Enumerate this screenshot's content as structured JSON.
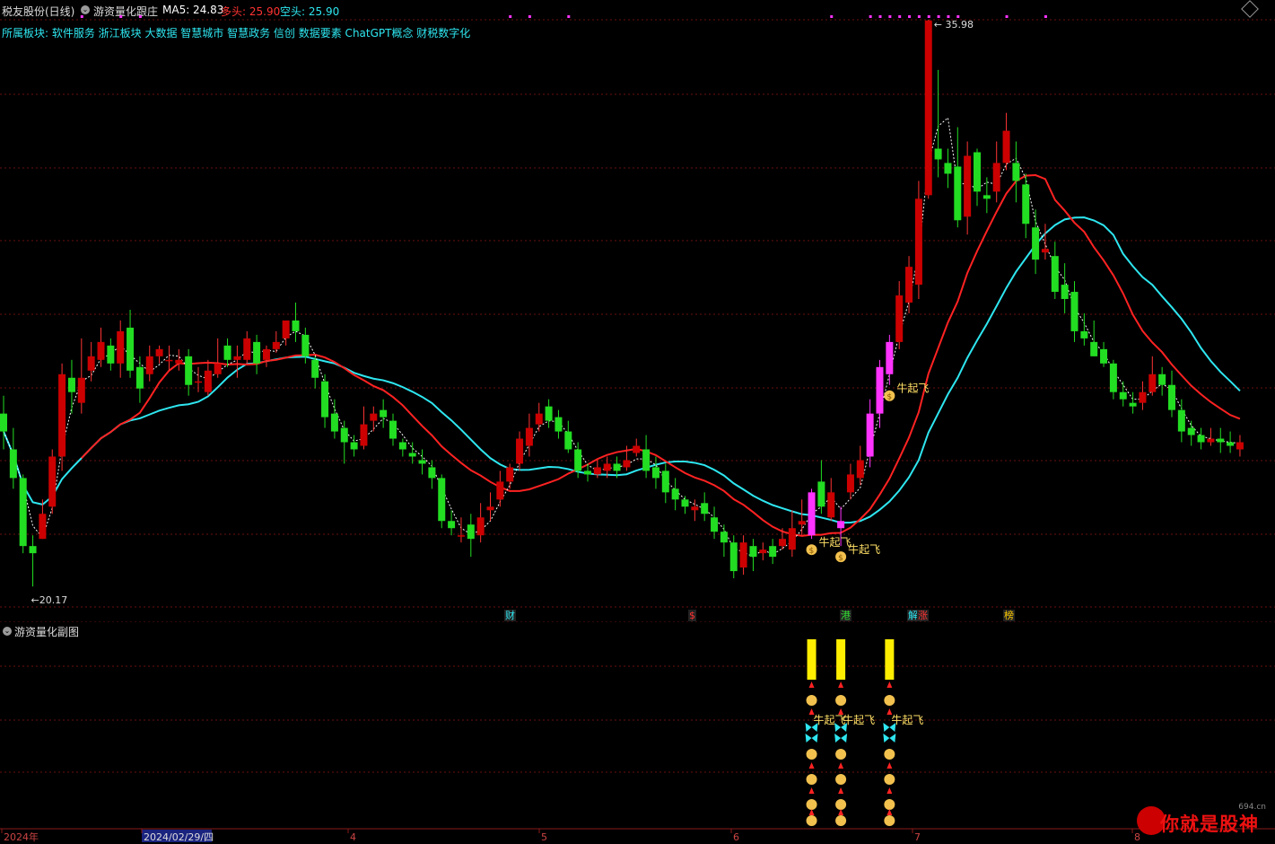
{
  "header": {
    "stock_name": "税友股份(日线)",
    "indicator_name": "游资量化跟庄",
    "ma5_label": "MA5: 24.83",
    "long_label": "多头: 25.90",
    "short_label": "空头: 25.90",
    "colors": {
      "ma5": "#ffffff",
      "long": "#ff3333",
      "short": "#2ee6f0"
    }
  },
  "sectors": "所属板块: 软件服务 浙江板块 大数据 智慧城市 智慧政务 信创 数据要素 ChatGPT概念 财税数字化",
  "main_chart": {
    "high_label": "35.98",
    "low_label": "←20.17",
    "signal_text": "牛起飞",
    "event_tags": [
      {
        "text": "财",
        "color": "#2ee6f0"
      },
      {
        "text": "$",
        "color": "#ff3333"
      },
      {
        "text": "港",
        "color": "#33dd33"
      },
      {
        "text": "解",
        "color": "#2ee6f0"
      },
      {
        "text": "涨",
        "color": "#ff3333"
      },
      {
        "text": "榜",
        "color": "#ffcc00"
      }
    ]
  },
  "sub_chart": {
    "title": "游资量化副图",
    "signal_text": "牛起飞"
  },
  "x_axis": {
    "labels": [
      "2024年",
      "2024/02/29/四",
      "4",
      "5",
      "6",
      "7",
      "8"
    ]
  },
  "watermark": {
    "domain": "694.cn",
    "text": "你就是股神"
  },
  "chart_data": {
    "type": "candlestick",
    "title": "游资量化跟庄",
    "y_high": 35.98,
    "y_low": 20.17,
    "candles": [
      [
        25.0,
        24.5,
        25.5,
        24.0
      ],
      [
        24.0,
        23.2,
        24.6,
        22.9
      ],
      [
        23.2,
        21.3,
        23.3,
        21.1
      ],
      [
        21.3,
        21.1,
        21.6,
        20.17
      ],
      [
        21.5,
        22.2,
        22.6,
        21.5
      ],
      [
        22.4,
        23.8,
        24.0,
        22.2
      ],
      [
        23.8,
        26.1,
        26.4,
        23.4
      ],
      [
        26.0,
        25.6,
        26.5,
        25.0
      ],
      [
        25.3,
        26.0,
        27.1,
        25.0
      ],
      [
        26.2,
        26.6,
        27.0,
        25.9
      ],
      [
        26.5,
        27.0,
        27.4,
        26.3
      ],
      [
        26.9,
        26.4,
        27.1,
        26.2
      ],
      [
        26.4,
        27.3,
        27.6,
        26.0
      ],
      [
        27.4,
        26.2,
        27.9,
        26.0
      ],
      [
        26.3,
        25.7,
        26.6,
        25.3
      ],
      [
        26.1,
        26.6,
        26.9,
        25.9
      ],
      [
        26.6,
        26.8,
        26.9,
        26.4
      ],
      [
        26.5,
        26.5,
        26.9,
        26.2
      ],
      [
        26.4,
        26.5,
        26.8,
        26.2
      ],
      [
        26.6,
        25.8,
        26.8,
        25.5
      ],
      [
        25.9,
        25.9,
        26.3,
        25.6
      ],
      [
        25.6,
        26.2,
        26.5,
        25.5
      ],
      [
        26.1,
        26.4,
        27.1,
        26.0
      ],
      [
        26.9,
        26.5,
        27.1,
        26.3
      ],
      [
        26.5,
        26.6,
        26.9,
        26.0
      ],
      [
        26.5,
        27.1,
        27.3,
        26.4
      ],
      [
        27.0,
        26.4,
        27.2,
        26.1
      ],
      [
        26.5,
        26.8,
        26.9,
        26.3
      ],
      [
        26.8,
        27.0,
        27.3,
        26.7
      ],
      [
        27.1,
        27.6,
        27.6,
        26.9
      ],
      [
        27.6,
        27.3,
        28.1,
        27.0
      ],
      [
        27.2,
        26.6,
        27.4,
        26.4
      ],
      [
        26.5,
        26.0,
        26.6,
        25.7
      ],
      [
        25.9,
        24.9,
        26.1,
        24.6
      ],
      [
        25.0,
        24.5,
        25.4,
        24.3
      ],
      [
        24.6,
        24.2,
        24.8,
        23.6
      ],
      [
        24.2,
        24.0,
        24.4,
        23.8
      ],
      [
        24.1,
        24.7,
        25.2,
        24.0
      ],
      [
        24.8,
        25.0,
        25.2,
        24.5
      ],
      [
        25.1,
        24.9,
        25.4,
        24.6
      ],
      [
        24.8,
        24.3,
        25.0,
        24.1
      ],
      [
        24.2,
        24.0,
        24.3,
        23.8
      ],
      [
        23.9,
        23.8,
        24.2,
        23.6
      ],
      [
        23.7,
        23.6,
        24.0,
        23.3
      ],
      [
        23.5,
        23.2,
        23.7,
        22.9
      ],
      [
        23.2,
        22.0,
        23.3,
        21.8
      ],
      [
        22.0,
        21.8,
        22.3,
        21.6
      ],
      [
        21.6,
        21.6,
        22.1,
        21.4
      ],
      [
        21.9,
        21.5,
        22.2,
        21.0
      ],
      [
        21.6,
        22.1,
        22.5,
        21.4
      ],
      [
        22.3,
        22.4,
        22.8,
        22.0
      ],
      [
        22.6,
        23.1,
        23.4,
        22.4
      ],
      [
        23.1,
        23.5,
        23.6,
        22.9
      ],
      [
        23.6,
        24.3,
        24.5,
        23.4
      ],
      [
        24.1,
        24.6,
        25.0,
        23.8
      ],
      [
        24.7,
        25.0,
        25.3,
        24.5
      ],
      [
        25.2,
        24.8,
        25.4,
        24.6
      ],
      [
        24.9,
        24.5,
        25.1,
        24.3
      ],
      [
        24.5,
        24.0,
        24.8,
        23.9
      ],
      [
        24.0,
        23.4,
        24.2,
        23.2
      ],
      [
        23.4,
        23.3,
        23.6,
        23.1
      ],
      [
        23.3,
        23.5,
        23.7,
        23.2
      ],
      [
        23.4,
        23.6,
        23.8,
        23.2
      ],
      [
        23.6,
        23.4,
        23.8,
        23.2
      ],
      [
        23.5,
        23.7,
        24.1,
        23.4
      ],
      [
        23.9,
        24.1,
        24.3,
        23.8
      ],
      [
        24.0,
        23.4,
        24.4,
        23.2
      ],
      [
        23.5,
        23.2,
        23.8,
        22.9
      ],
      [
        23.4,
        22.8,
        23.6,
        22.5
      ],
      [
        22.9,
        22.6,
        23.2,
        22.3
      ],
      [
        22.6,
        22.4,
        22.7,
        22.2
      ],
      [
        22.3,
        22.4,
        22.6,
        22.0
      ],
      [
        22.5,
        22.2,
        22.8,
        22.0
      ],
      [
        22.1,
        21.7,
        22.4,
        21.5
      ],
      [
        21.7,
        21.4,
        21.9,
        21.0
      ],
      [
        21.4,
        20.6,
        21.6,
        20.4
      ],
      [
        20.7,
        21.4,
        21.6,
        20.5
      ],
      [
        21.3,
        21.0,
        21.5,
        20.6
      ],
      [
        21.1,
        21.2,
        21.4,
        20.9
      ],
      [
        21.3,
        21.0,
        21.5,
        20.8
      ],
      [
        21.3,
        21.5,
        21.8,
        21.2
      ],
      [
        21.2,
        21.8,
        22.3,
        21.0
      ],
      [
        21.9,
        22.0,
        22.6,
        21.6
      ],
      [
        21.6,
        22.8,
        22.9,
        21.5
      ],
      [
        23.1,
        22.4,
        23.7,
        22.2
      ],
      [
        22.1,
        22.8,
        23.2,
        22.0
      ],
      [
        22.0,
        21.8,
        22.4,
        21.3
      ],
      [
        22.8,
        23.3,
        23.6,
        22.6
      ],
      [
        23.2,
        23.7,
        24.1,
        23.0
      ],
      [
        23.8,
        25.0,
        25.4,
        23.5
      ],
      [
        25.0,
        26.3,
        26.5,
        24.6
      ],
      [
        26.1,
        27.0,
        27.2,
        25.8
      ],
      [
        27.0,
        28.3,
        28.7,
        26.8
      ],
      [
        28.1,
        29.1,
        29.4,
        27.8
      ],
      [
        28.6,
        31.0,
        31.5,
        28.2
      ],
      [
        31.1,
        35.98,
        36.0,
        31.0
      ],
      [
        32.4,
        32.1,
        34.6,
        31.6
      ],
      [
        32.0,
        31.7,
        32.4,
        31.3
      ],
      [
        31.9,
        30.4,
        33.0,
        30.2
      ],
      [
        30.5,
        32.2,
        32.6,
        30.0
      ],
      [
        32.3,
        31.2,
        32.4,
        30.8
      ],
      [
        31.1,
        31.0,
        31.6,
        30.6
      ],
      [
        31.2,
        32.0,
        32.6,
        30.9
      ],
      [
        32.0,
        32.9,
        33.4,
        31.8
      ],
      [
        32.0,
        31.5,
        32.6,
        30.9
      ],
      [
        31.4,
        30.3,
        31.7,
        29.9
      ],
      [
        30.2,
        29.3,
        30.7,
        28.9
      ],
      [
        29.5,
        29.6,
        30.3,
        29.3
      ],
      [
        29.4,
        28.4,
        29.8,
        28.2
      ],
      [
        28.6,
        28.2,
        29.2,
        27.8
      ],
      [
        28.4,
        27.3,
        28.7,
        27.0
      ],
      [
        27.3,
        27.1,
        27.8,
        26.9
      ],
      [
        27.0,
        26.6,
        27.6,
        26.6
      ],
      [
        26.8,
        26.4,
        27.0,
        26.3
      ],
      [
        26.4,
        25.6,
        26.5,
        25.4
      ],
      [
        25.6,
        25.4,
        25.9,
        25.2
      ],
      [
        25.3,
        25.2,
        25.6,
        25.0
      ],
      [
        25.3,
        25.6,
        25.9,
        25.1
      ],
      [
        25.6,
        26.1,
        26.6,
        25.5
      ],
      [
        26.1,
        25.8,
        26.3,
        25.5
      ],
      [
        25.8,
        25.1,
        26.2,
        24.9
      ],
      [
        25.1,
        24.5,
        25.4,
        24.2
      ],
      [
        24.6,
        24.4,
        24.8,
        24.1
      ],
      [
        24.4,
        24.2,
        24.6,
        24.0
      ],
      [
        24.2,
        24.3,
        24.6,
        24.1
      ],
      [
        24.3,
        24.2,
        24.6,
        23.9
      ],
      [
        24.2,
        24.1,
        24.5,
        23.9
      ],
      [
        24.0,
        24.2,
        24.4,
        23.8
      ]
    ],
    "signals": [
      {
        "label": "牛起飞",
        "candle_index": 83
      },
      {
        "label": "牛起飞",
        "candle_index": 86
      },
      {
        "label": "牛起飞",
        "candle_index": 91
      }
    ]
  }
}
